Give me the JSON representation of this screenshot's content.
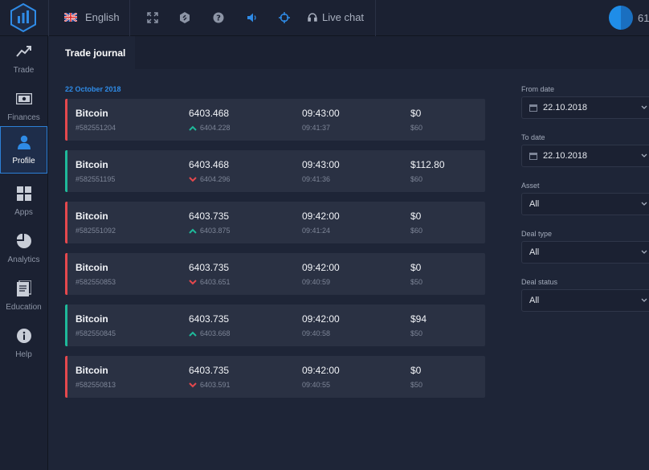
{
  "topbar": {
    "language": "English",
    "live_chat": "Live chat",
    "avatar_text": "61",
    "icons": [
      "fullscreen-icon",
      "shield-icon",
      "help-circle-icon",
      "volume-icon",
      "crosshair-icon",
      "headset-icon"
    ]
  },
  "sidebar": {
    "items": [
      {
        "label": "Trade",
        "icon": "trend-up-icon"
      },
      {
        "label": "Finances",
        "icon": "banknote-icon"
      },
      {
        "label": "Profile",
        "icon": "user-icon",
        "active": true
      },
      {
        "label": "Apps",
        "icon": "grid-icon"
      },
      {
        "label": "Analytics",
        "icon": "pie-chart-icon"
      },
      {
        "label": "Education",
        "icon": "book-icon"
      },
      {
        "label": "Help",
        "icon": "info-icon"
      }
    ]
  },
  "tabs": {
    "active": "Trade journal"
  },
  "journal": {
    "date": "22 October 2018",
    "trades": [
      {
        "asset": "Bitcoin",
        "id": "#582551204",
        "close_price": "6403.468",
        "open_price": "6404.228",
        "direction": "up",
        "close_time": "09:43:00",
        "open_time": "09:41:37",
        "payout": "$0",
        "amount": "$60",
        "result": "loss"
      },
      {
        "asset": "Bitcoin",
        "id": "#582551195",
        "close_price": "6403.468",
        "open_price": "6404.296",
        "direction": "down",
        "close_time": "09:43:00",
        "open_time": "09:41:36",
        "payout": "$112.80",
        "amount": "$60",
        "result": "win"
      },
      {
        "asset": "Bitcoin",
        "id": "#582551092",
        "close_price": "6403.735",
        "open_price": "6403.875",
        "direction": "up",
        "close_time": "09:42:00",
        "open_time": "09:41:24",
        "payout": "$0",
        "amount": "$60",
        "result": "loss"
      },
      {
        "asset": "Bitcoin",
        "id": "#582550853",
        "close_price": "6403.735",
        "open_price": "6403.651",
        "direction": "down",
        "close_time": "09:42:00",
        "open_time": "09:40:59",
        "payout": "$0",
        "amount": "$50",
        "result": "loss"
      },
      {
        "asset": "Bitcoin",
        "id": "#582550845",
        "close_price": "6403.735",
        "open_price": "6403.668",
        "direction": "up",
        "close_time": "09:42:00",
        "open_time": "09:40:58",
        "payout": "$94",
        "amount": "$50",
        "result": "win"
      },
      {
        "asset": "Bitcoin",
        "id": "#582550813",
        "close_price": "6403.735",
        "open_price": "6403.591",
        "direction": "down",
        "close_time": "09:42:00",
        "open_time": "09:40:55",
        "payout": "$0",
        "amount": "$50",
        "result": "loss"
      }
    ]
  },
  "filters": {
    "from_date_label": "From date",
    "from_date_value": "22.10.2018",
    "to_date_label": "To date",
    "to_date_value": "22.10.2018",
    "asset_label": "Asset",
    "asset_value": "All",
    "deal_type_label": "Deal type",
    "deal_type_value": "All",
    "deal_status_label": "Deal status",
    "deal_status_value": "All"
  },
  "colors": {
    "accent": "#2f8be6",
    "win": "#1fb99a",
    "loss": "#e5484d",
    "background": "#1e2537",
    "panel": "#1b2132",
    "card": "#2a3143"
  }
}
